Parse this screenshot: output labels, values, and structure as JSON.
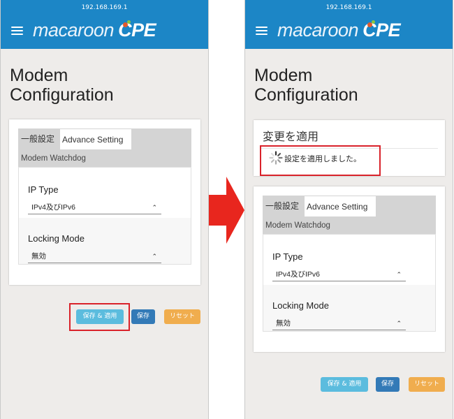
{
  "status_bar": {
    "ip": "192.168.169.1"
  },
  "header": {
    "logo_main": "macaroon",
    "logo_suffix": "CPE",
    "brand_color": "#1c86c6"
  },
  "page": {
    "title_line1": "Modem",
    "title_line2": "Configuration"
  },
  "tabs": {
    "general": "一般設定",
    "advance": "Advance Setting",
    "sub": "Modem Watchdog"
  },
  "form": {
    "ip_type_label": "IP Type",
    "ip_type_value": "IPv4及びIPv6",
    "locking_label": "Locking Mode",
    "locking_value": "無効"
  },
  "buttons": {
    "apply": "保存 & 適用",
    "save": "保存",
    "reset": "リセット"
  },
  "apply_notice": {
    "title": "変更を適用",
    "message": "設定を適用しました。"
  },
  "colors": {
    "highlight": "#d9222a",
    "arrow": "#e8261e",
    "apply": "#5bbcde",
    "save": "#337ab7",
    "reset": "#f0ad4e"
  }
}
